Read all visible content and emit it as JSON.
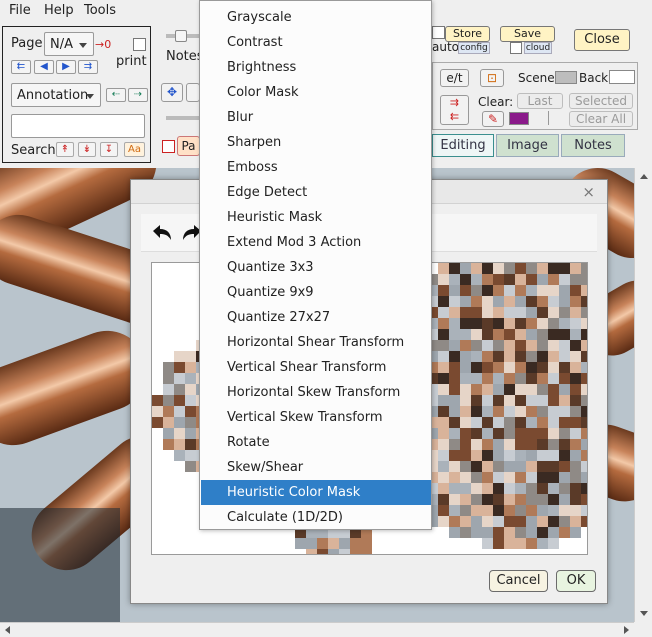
{
  "menubar": {
    "items": [
      "File",
      "Help",
      "Tools"
    ]
  },
  "toolbar": {
    "page_label": "Page",
    "page_value": "N/A",
    "page_arrow_count": "→0",
    "print_label": "print",
    "nav_buttons": [
      "⇇",
      "◀",
      "▶",
      "⇉"
    ],
    "annotation_value": "Annotation",
    "annotation_nav": [
      "⇠",
      "⇢"
    ],
    "search_label": "Search",
    "search_value": "",
    "search_buttons": [
      "↟",
      "↡",
      "↧"
    ],
    "case_button": "Aa",
    "notes_label": "Notes",
    "pa_button": "Pa",
    "store_button": "Store",
    "save_button": "Save",
    "close_button": "Close",
    "auto_label": "auto",
    "config_label": "config",
    "cloud_label": "cloud",
    "et_button": "e/t",
    "scene_label": "Scene",
    "back_label": "Back",
    "clear_label": "Clear:",
    "last_button": "Last",
    "selected_button": "Selected",
    "clear_all_button": "Clear All",
    "tabs": [
      "Editing",
      "Image",
      "Notes"
    ],
    "active_tab": "Editing",
    "colors": {
      "swatch_scene": "#bdbdbd",
      "swatch_back": "#ffffff",
      "swatch_purple": "#8a1a8a",
      "accent_red": "#cc2222",
      "accent_blue": "#2255cc"
    }
  },
  "dialog": {
    "close_glyph": "×",
    "undo_icon": "undo-arrow",
    "redo_icon": "redo-arrow",
    "cancel_button": "Cancel",
    "ok_button": "OK"
  },
  "dropdown": {
    "items": [
      "Grayscale",
      "Contrast",
      "Brightness",
      "Color Mask",
      "Blur",
      "Sharpen",
      "Emboss",
      "Edge Detect",
      "Heuristic Mask",
      "Extend Mod 3 Action",
      "Quantize 3x3",
      "Quantize 9x9",
      "Quantize 27x27",
      "Horizontal Shear Transform",
      "Vertical Shear Transform",
      "Horizontal Skew Transform",
      "Vertical Skew Transform",
      "Rotate",
      "Skew/Shear",
      "Heuristic Color Mask",
      "Calculate (1D/2D)"
    ],
    "selected": "Heuristic Color Mask"
  }
}
